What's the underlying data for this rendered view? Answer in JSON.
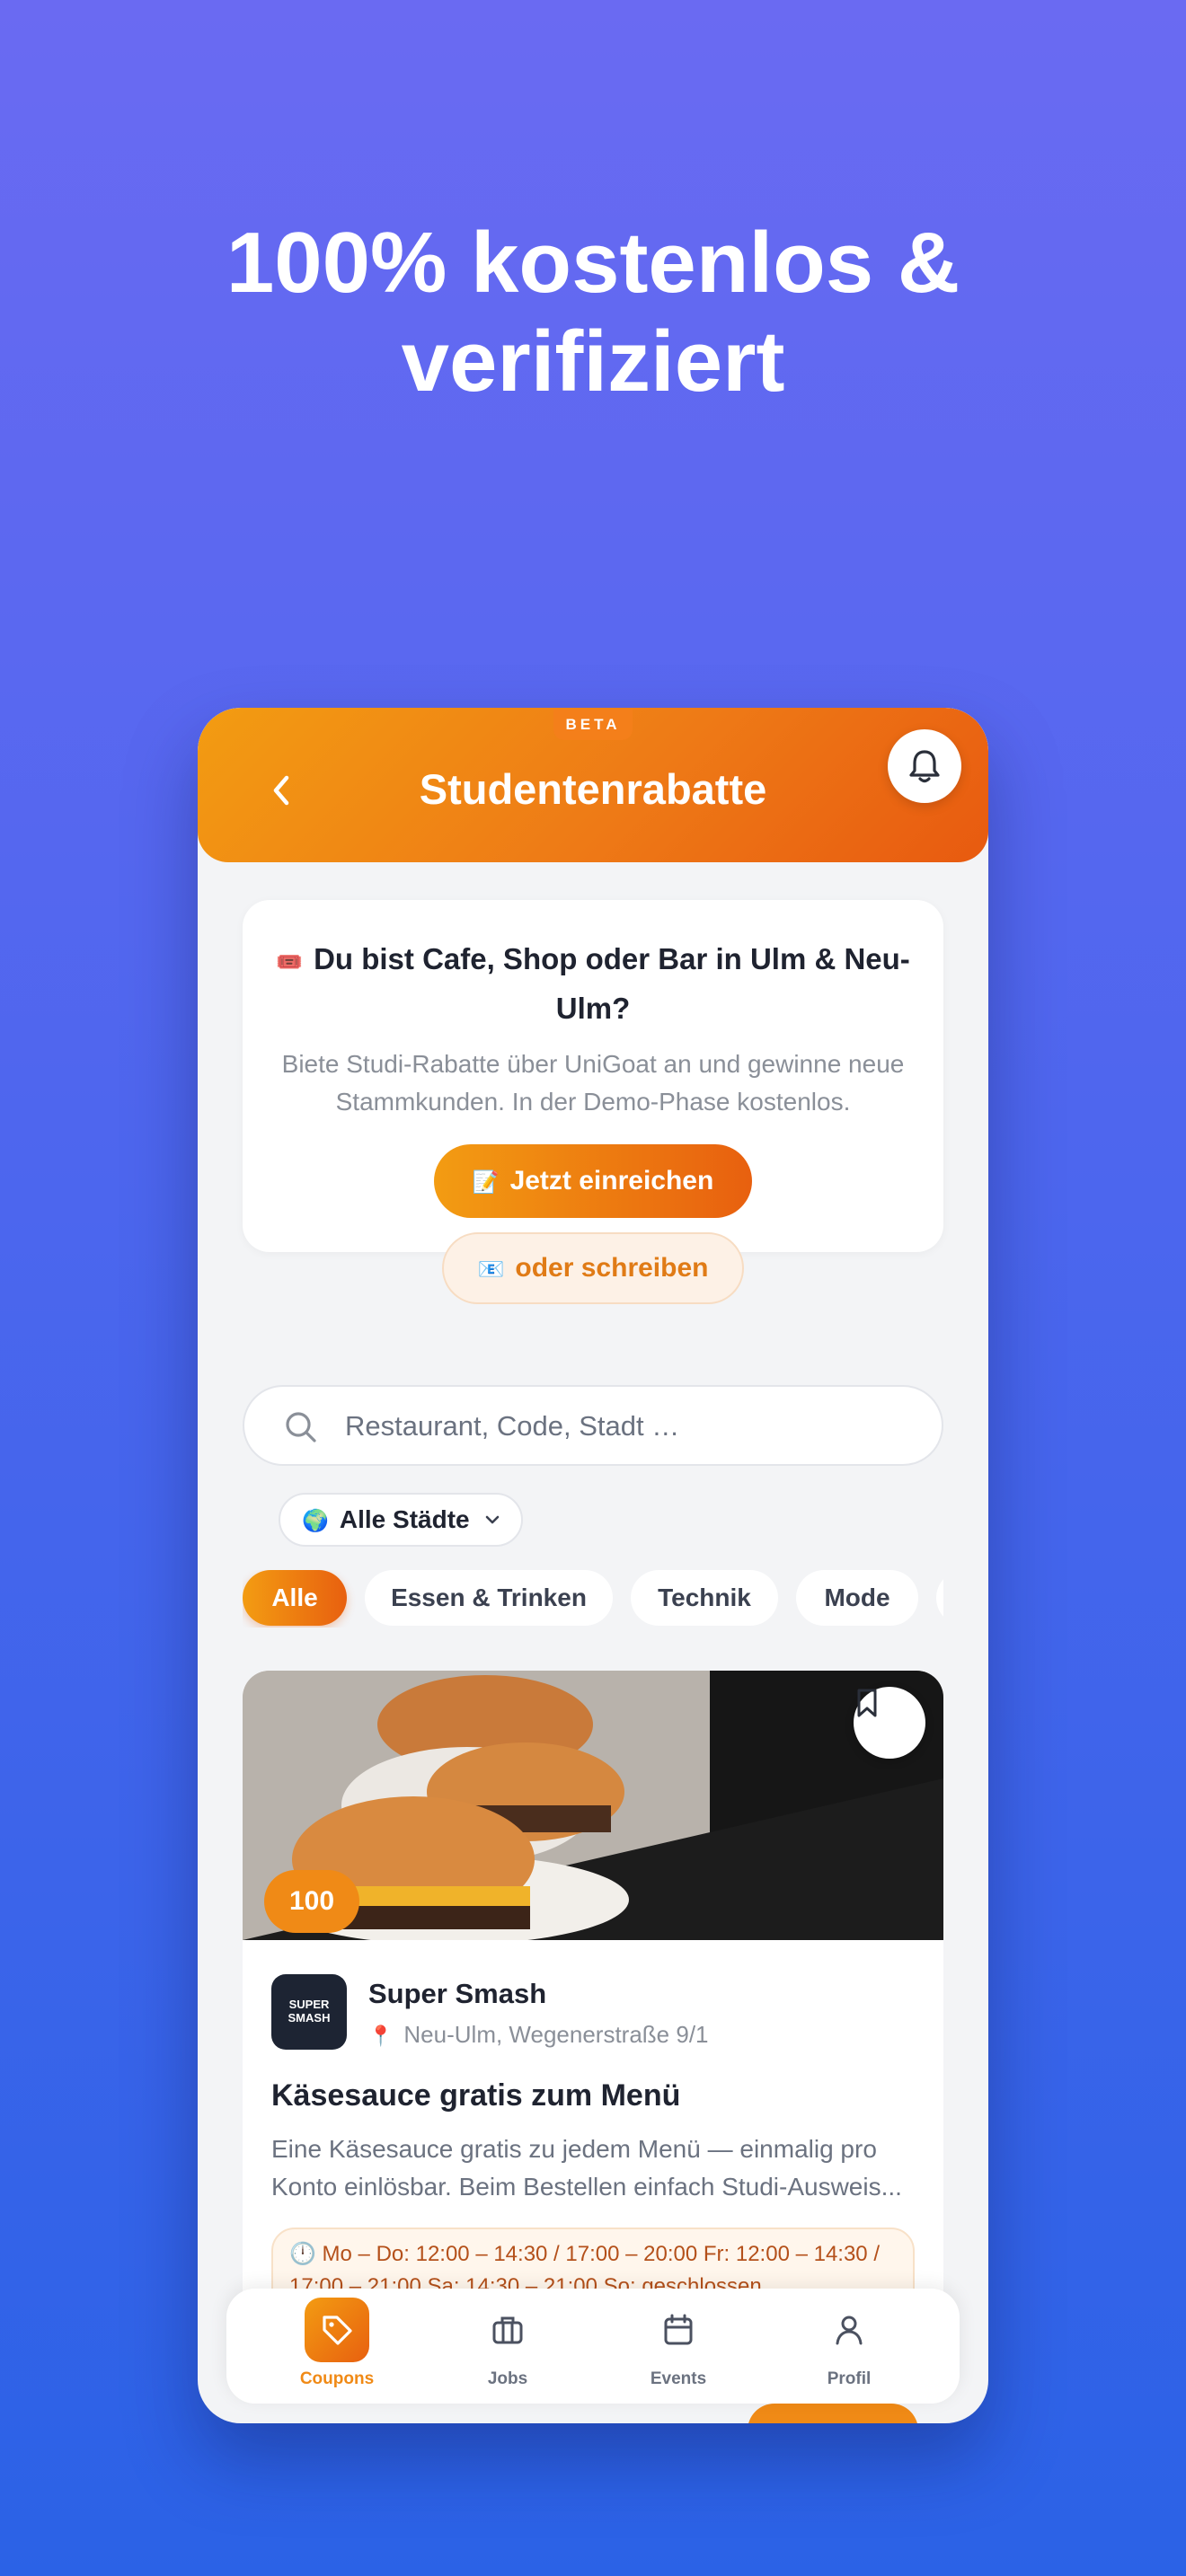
{
  "headline": {
    "line1": "100% kostenlos &",
    "line2": "verifiziert"
  },
  "appbar": {
    "badge": "BETA",
    "title": "Studentenrabatte",
    "back_icon": "chevron-left-icon",
    "bell_icon": "bell-icon"
  },
  "promo": {
    "emoji": "🎟️",
    "title": "Du bist Cafe, Shop oder Bar in Ulm & Neu-Ulm?",
    "text": "Biete Studi-Rabatte über UniGoat an und gewinne neue Stammkunden. In der Demo-Phase kostenlos.",
    "submit_emoji": "📝",
    "submit_label": "Jetzt einreichen",
    "write_emoji": "📧",
    "write_label": "oder schreiben"
  },
  "search": {
    "placeholder": "Restaurant, Code, Stadt …"
  },
  "city_filter": {
    "emoji": "🌍",
    "label": "Alle Städte"
  },
  "categories": [
    "Alle",
    "Essen & Trinken",
    "Technik",
    "Mode"
  ],
  "deal": {
    "points": "100",
    "shop_logo_text": "SUPER SMASH",
    "shop_name": "Super Smash",
    "location": "Neu-Ulm, Wegenerstraße 9/1",
    "title": "Käsesauce gratis zum Menü",
    "description_line1": "Eine Käsesauce gratis zu jedem Menü — einmalig pro",
    "description_line2": "Konto einlösbar. Beim Bestellen einfach Studi-Ausweis...",
    "hours_line1": "🕛 Mo – Do: 12:00 – 14:30 / 17:00 – 20:00 Fr: 12:00 – 14:30 /",
    "hours_line2": "17:00 – 21:00 Sa: 14:30 – 21:00 So: geschlossen"
  },
  "nav": [
    {
      "label": "Coupons",
      "icon": "tag-icon",
      "active": true
    },
    {
      "label": "Jobs",
      "icon": "briefcase-icon",
      "active": false
    },
    {
      "label": "Events",
      "icon": "calendar-icon",
      "active": false
    },
    {
      "label": "Profil",
      "icon": "user-icon",
      "active": false
    }
  ],
  "colors": {
    "accent": "#f08a16",
    "accent_dark": "#e8600f",
    "background_top": "#6a6af2",
    "background_bottom": "#2b62e6"
  }
}
